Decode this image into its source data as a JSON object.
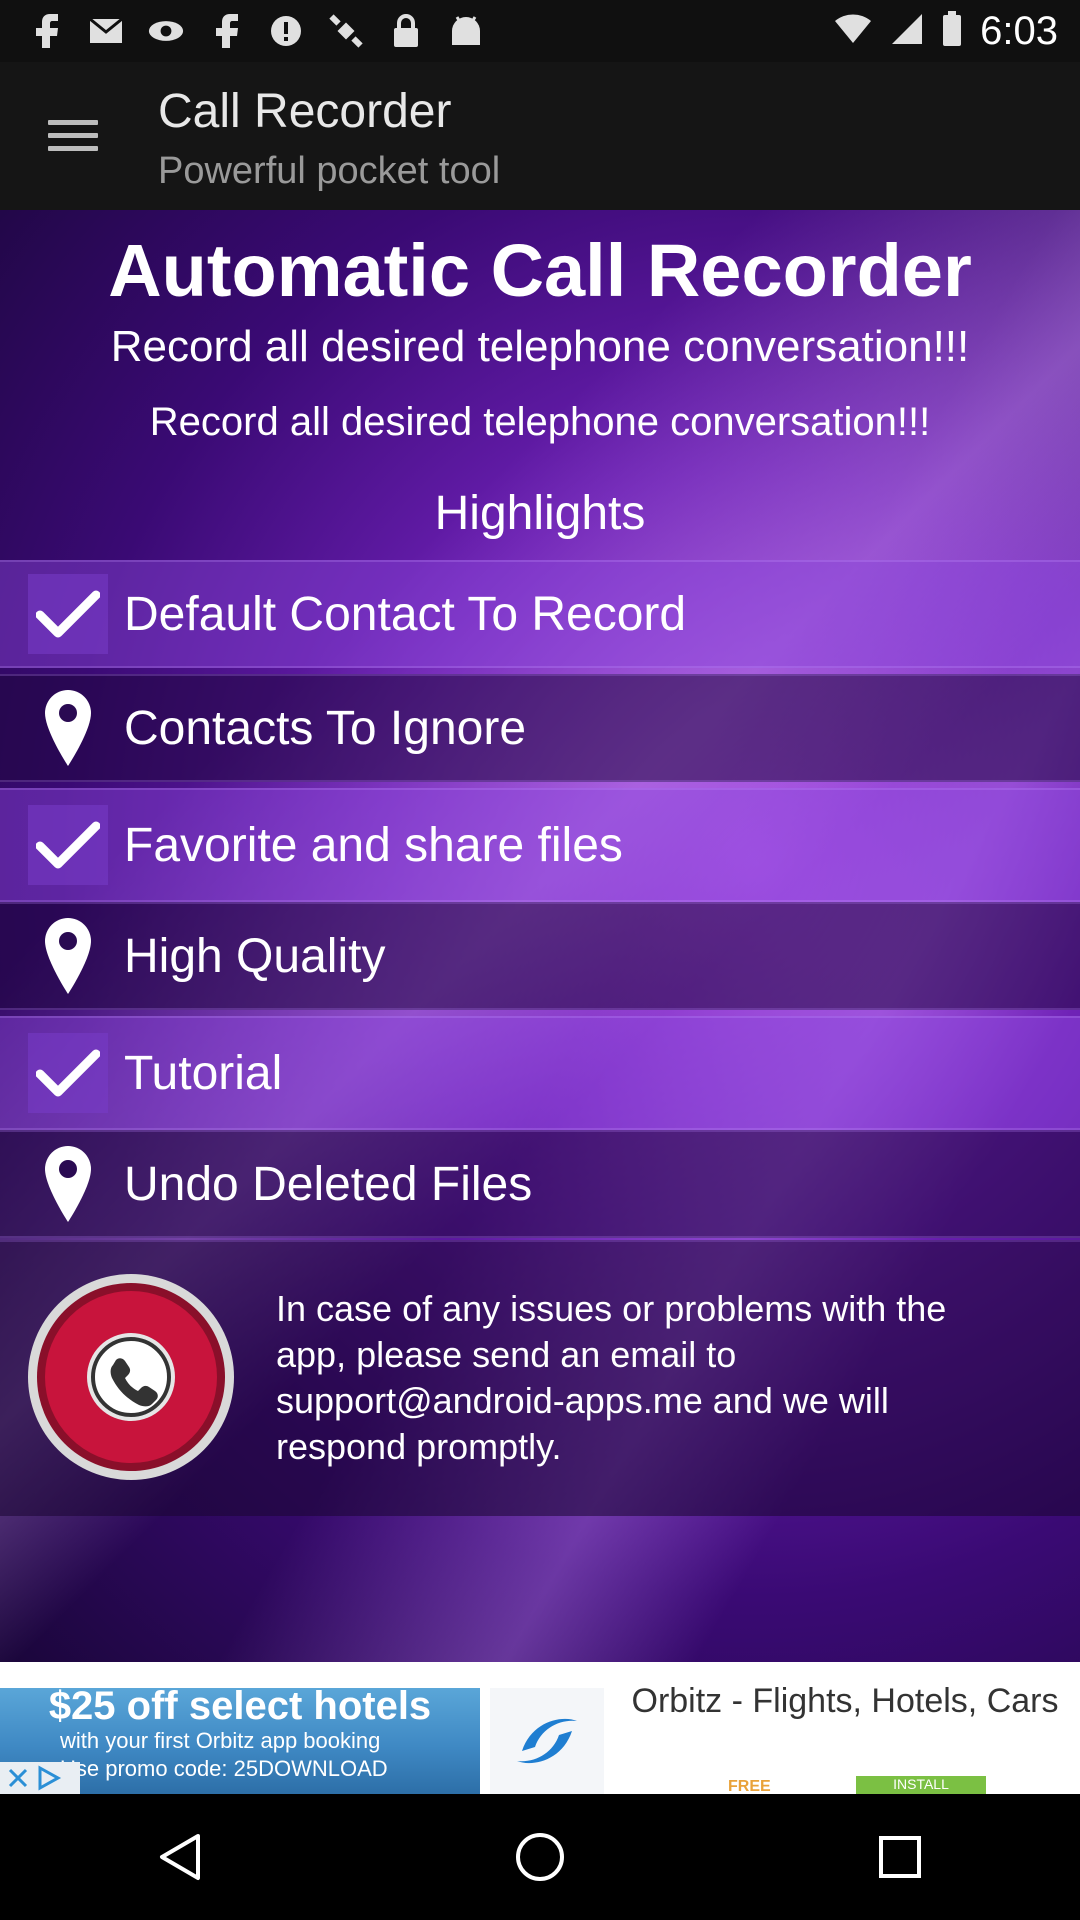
{
  "status_bar": {
    "time": "6:03",
    "notification_icons": [
      "facebook-icon",
      "mail-icon",
      "eye-icon",
      "facebook-icon",
      "info-icon",
      "satellite-icon",
      "lock-icon",
      "android-icon"
    ],
    "system_icons": [
      "wifi-icon",
      "signal-icon",
      "battery-icon"
    ]
  },
  "app_bar": {
    "title": "Call Recorder",
    "subtitle": "Powerful pocket tool",
    "menu_icon": "hamburger-menu-icon"
  },
  "main": {
    "title": "Automatic Call Recorder",
    "subtitle_1": "Record all desired telephone conversation!!!",
    "subtitle_2": "Record all desired telephone conversation!!!",
    "highlights_heading": "Highlights",
    "items": [
      {
        "label": "Default Contact To Record",
        "icon": "checkmark-icon"
      },
      {
        "label": "Contacts To Ignore",
        "icon": "location-pin-icon"
      },
      {
        "label": "Favorite and share files",
        "icon": "checkmark-icon"
      },
      {
        "label": "High Quality",
        "icon": "location-pin-icon"
      },
      {
        "label": "Tutorial",
        "icon": "checkmark-icon"
      },
      {
        "label": "Undo Deleted Files",
        "icon": "location-pin-icon"
      }
    ],
    "support_text": "In case of any issues or problems with the app, please send an email to support@android-apps.me and we will respond promptly."
  },
  "ad": {
    "headline": "$25 off select hotels",
    "line_1": "with your first Orbitz app booking",
    "line_2": "Use promo code: 25DOWNLOAD",
    "title": "Orbitz - Flights, Hotels, Cars",
    "footer_left": "FREE",
    "footer_right": "INSTALL"
  },
  "colors": {
    "accent_purple": "#6b1fb3",
    "record_button_red": "#c8143c"
  }
}
